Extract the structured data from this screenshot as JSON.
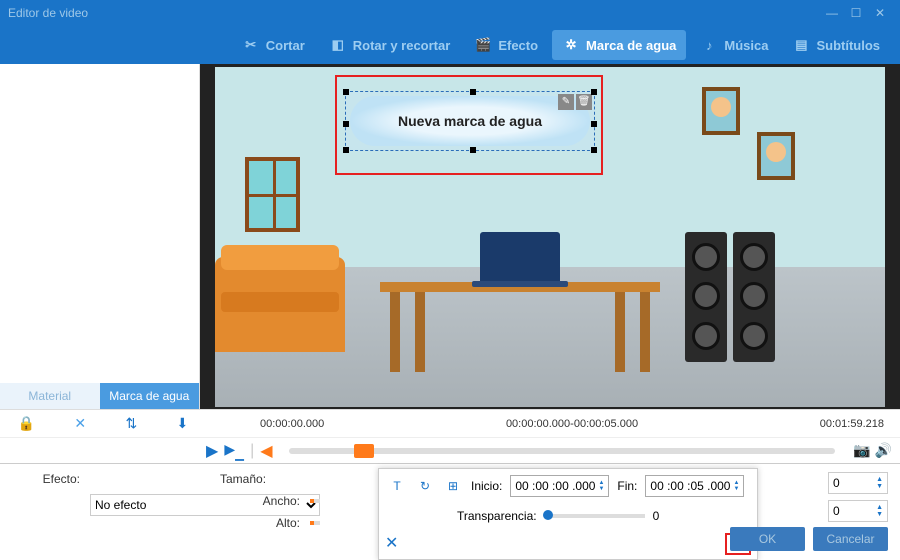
{
  "window": {
    "title": "Editor de video"
  },
  "toolbar": {
    "cut": "Cortar",
    "rotate": "Rotar y recortar",
    "effect": "Efecto",
    "watermark": "Marca de agua",
    "music": "Música",
    "subtitles": "Subtítulos"
  },
  "leftpanel": {
    "tabs": {
      "material": "Material",
      "watermark": "Marca de agua"
    }
  },
  "watermark": {
    "text": "Nueva marca de agua"
  },
  "timeline": {
    "start": "00:00:00.000",
    "range": "00:00:00.000-00:00:05.000",
    "end": "00:01:59.218"
  },
  "props": {
    "effect_label": "Efecto:",
    "effect_value": "No efecto",
    "size_label": "Tamaño:",
    "width_label": "Ancho:",
    "height_label": "Alto:"
  },
  "popup": {
    "start_label": "Inicio:",
    "start_value": "00 :00 :00 .000",
    "end_label": "Fin:",
    "end_value": "00 :00 :05 .000",
    "transparency_label": "Transparencia:",
    "transparency_value": "0"
  },
  "steppers": {
    "w": "0",
    "h": "0"
  },
  "buttons": {
    "ok": "OK",
    "cancel": "Cancelar"
  }
}
